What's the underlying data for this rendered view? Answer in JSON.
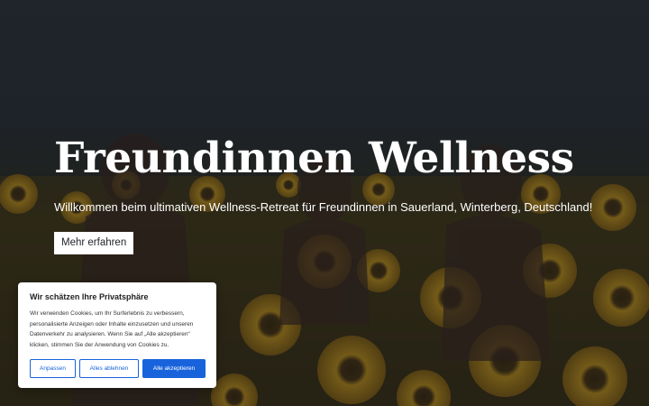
{
  "hero": {
    "title": "Freundinnen Wellness",
    "subtitle": "Willkommen beim ultimativen Wellness-Retreat für Freundinnen in Sauerland, Winterberg, Deutschland!",
    "button_label": "Mehr erfahren"
  },
  "cookie_banner": {
    "title": "Wir schätzen Ihre Privatsphäre",
    "text": "Wir verwenden Cookies, um Ihr Surferlebnis zu verbessern, personalisierte Anzeigen oder Inhalte einzusetzen und unseren Datenverkehr zu analysieren. Wenn Sie auf „Alle akzeptieren“ klicken, stimmen Sie der Anwendung von Cookies zu.",
    "customize_label": "Anpassen",
    "reject_label": "Alles ablehnen",
    "accept_label": "Alle akzeptieren"
  },
  "colors": {
    "accent": "#1863dc",
    "sky": "#2d3439",
    "sunflower": "#c99a1e"
  }
}
